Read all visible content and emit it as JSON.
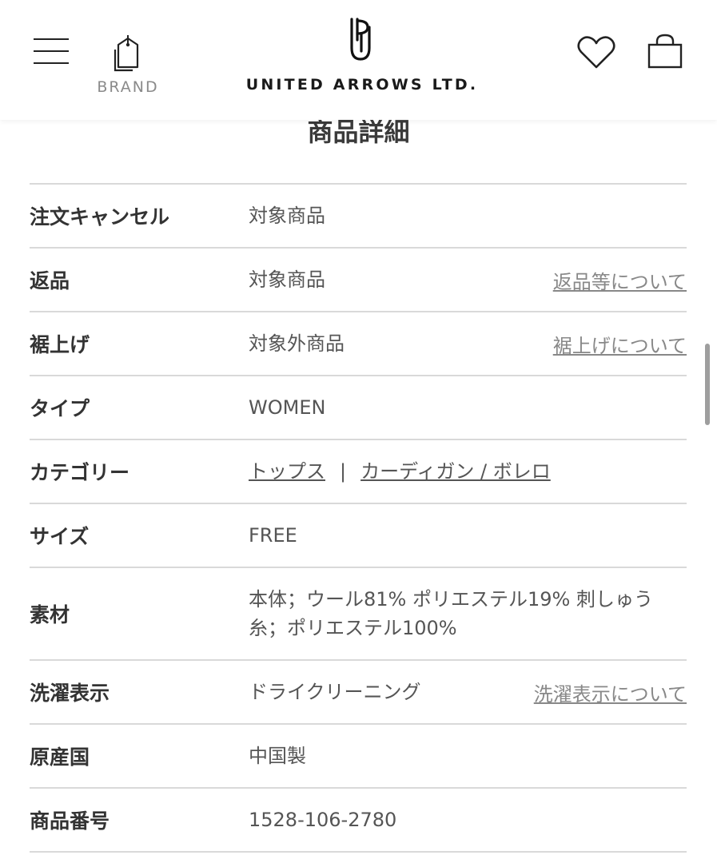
{
  "header": {
    "brand_label": "BRAND",
    "logo_text": "UNITED ARROWS LTD."
  },
  "section": {
    "title": "商品詳細"
  },
  "details": {
    "order_cancel": {
      "label": "注文キャンセル",
      "value": "対象商品"
    },
    "returns": {
      "label": "返品",
      "value": "対象商品",
      "link": "返品等について"
    },
    "hemming": {
      "label": "裾上げ",
      "value": "対象外商品",
      "link": "裾上げについて"
    },
    "type": {
      "label": "タイプ",
      "value": "WOMEN"
    },
    "category": {
      "label": "カテゴリー",
      "link1": "トップス",
      "separator": "|",
      "link2": "カーディガン / ボレロ"
    },
    "size": {
      "label": "サイズ",
      "value": "FREE"
    },
    "material": {
      "label": "素材",
      "value": "本体；ウール81% ポリエステル19% 刺しゅう糸；ポリエステル100%"
    },
    "care": {
      "label": "洗濯表示",
      "value": "ドライクリーニング",
      "link": "洗濯表示について"
    },
    "origin": {
      "label": "原産国",
      "value": "中国製"
    },
    "product_number": {
      "label": "商品番号",
      "value": "1528-106-2780"
    }
  },
  "icons": {
    "menu": "hamburger-menu-icon",
    "brand": "tag-icon",
    "favorite": "heart-icon",
    "bag": "shopping-bag-icon"
  },
  "colors": {
    "text_label": "#333333",
    "text_value": "#555555",
    "link_muted": "#888888",
    "divider": "#d9d9d9"
  }
}
